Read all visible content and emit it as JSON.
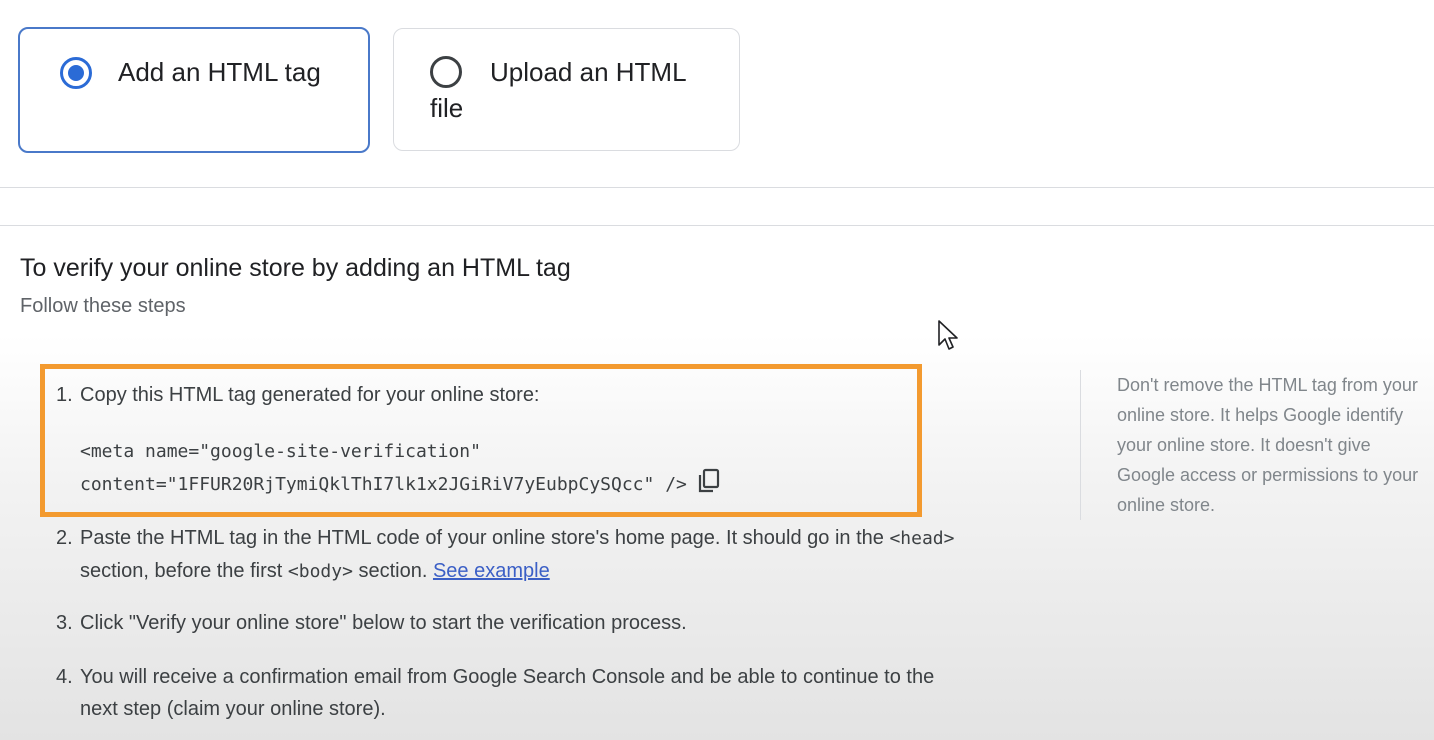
{
  "methods": {
    "html_tag": {
      "label": "Add an HTML tag",
      "selected": true
    },
    "html_file": {
      "label": "Upload an HTML file",
      "selected": false
    }
  },
  "instructions": {
    "title": "To verify your online store by adding an HTML tag",
    "subtitle": "Follow these steps"
  },
  "steps": {
    "s1": {
      "num": "1.",
      "text": "Copy this HTML tag generated for your online store:",
      "code_line1": "<meta name=\"google-site-verification\"",
      "code_line2": "content=\"1FFUR20RjTymiQklThI7lk1x2JGiRiV7yEubpCySQcc\" />"
    },
    "s2": {
      "num": "2.",
      "text_a": "Paste the HTML tag in the HTML code of your online store's home page. It should go in the ",
      "code_head": "<head>",
      "text_b": "section, before the first ",
      "code_body": "<body>",
      "text_c": " section. ",
      "link": "See example"
    },
    "s3": {
      "num": "3.",
      "text": "Click \"Verify your online store\" below to start the verification process."
    },
    "s4": {
      "num": "4.",
      "text_a": "You will receive a confirmation email from Google Search Console and be able to continue to the",
      "text_b": "next step (claim your online store)."
    }
  },
  "side_note": "Don't remove the HTML tag from your online store. It helps Google identify your online store. It doesn't give Google access or permissions to your online store.",
  "colors": {
    "accent": "#2b6bd6",
    "highlight": "#f39a2f",
    "link": "#3b5fc6"
  },
  "icons": [
    "radio-checked-icon",
    "radio-unchecked-icon",
    "copy-icon",
    "mouse-cursor-icon"
  ]
}
